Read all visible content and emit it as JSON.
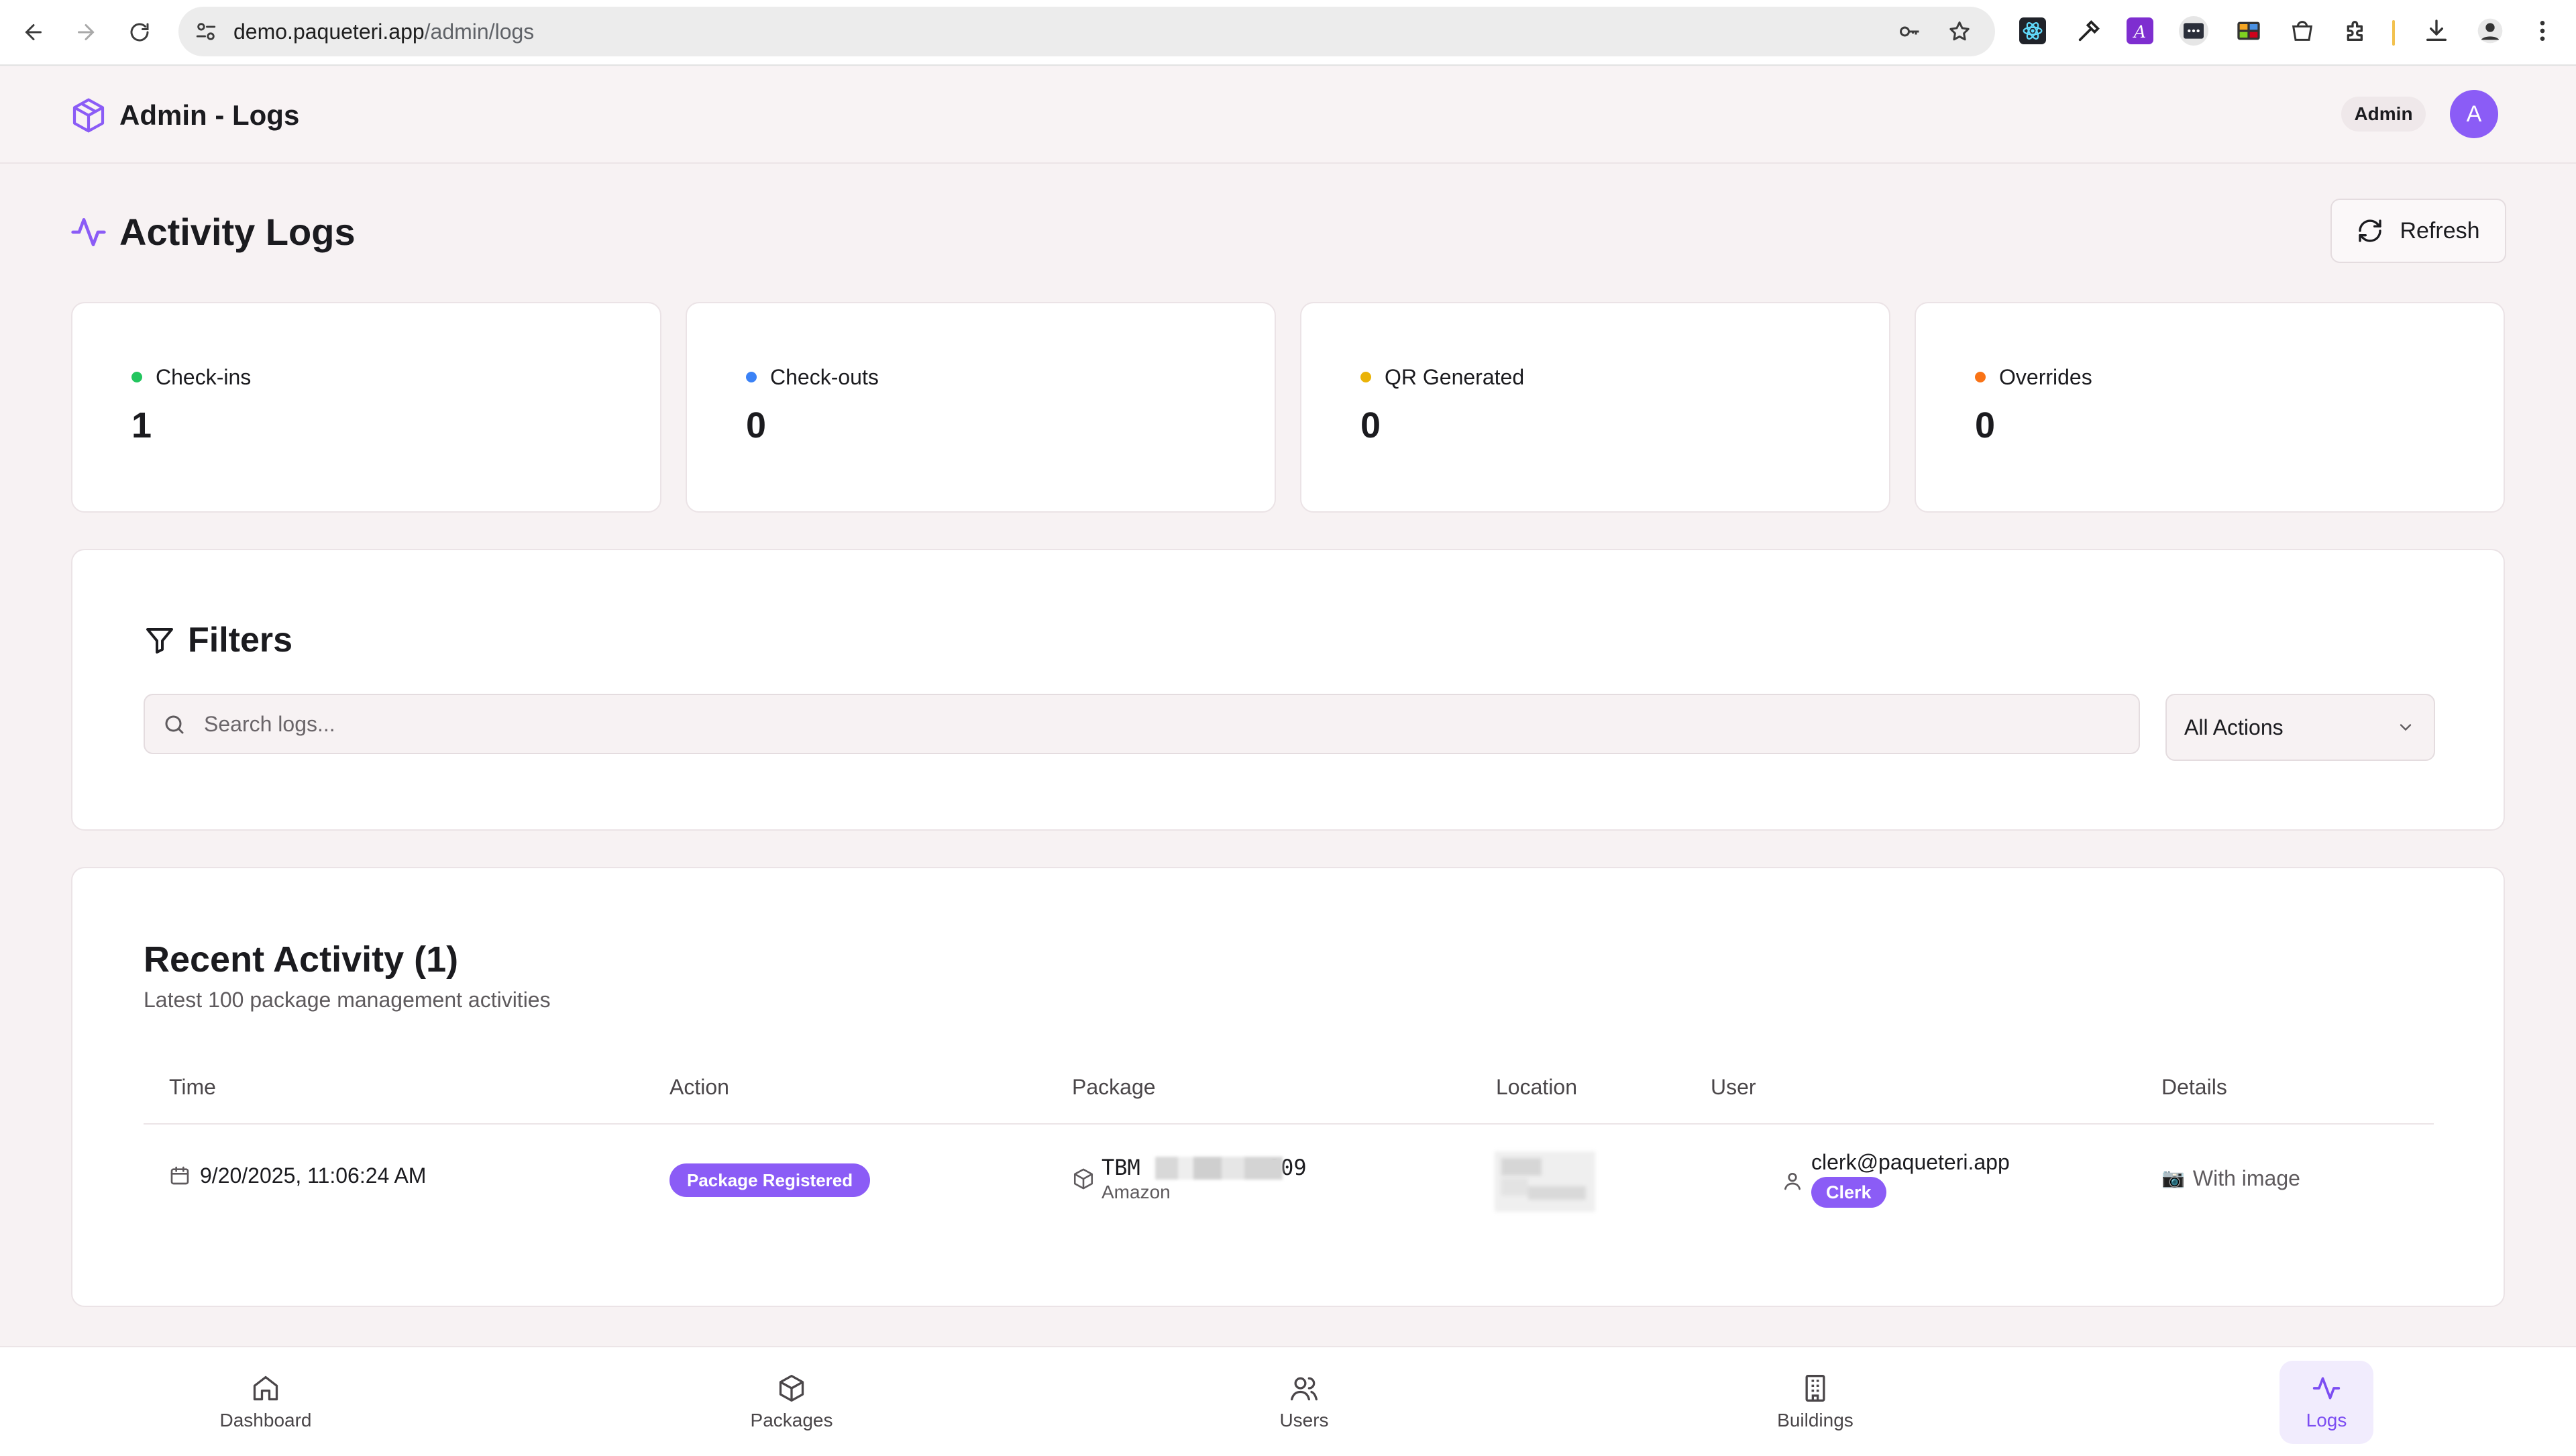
{
  "browser": {
    "url_domain": "demo.paqueteri.app",
    "url_path": "/admin/logs"
  },
  "header": {
    "title": "Admin - Logs",
    "role": "Admin",
    "avatar_initial": "A"
  },
  "page": {
    "title": "Activity Logs",
    "refresh_label": "Refresh"
  },
  "stats": [
    {
      "label": "Check-ins",
      "value": "1",
      "color": "#22c55e"
    },
    {
      "label": "Check-outs",
      "value": "0",
      "color": "#3b82f6"
    },
    {
      "label": "QR Generated",
      "value": "0",
      "color": "#eab308"
    },
    {
      "label": "Overrides",
      "value": "0",
      "color": "#f97316"
    }
  ],
  "filters": {
    "title": "Filters",
    "search_placeholder": "Search logs...",
    "search_value": "",
    "action_selected": "All Actions"
  },
  "activity": {
    "title": "Recent Activity (1)",
    "subtitle": "Latest 100 package management activities",
    "columns": [
      "Time",
      "Action",
      "Package",
      "Location",
      "User",
      "Details"
    ],
    "rows": [
      {
        "time": "9/20/2025, 11:06:24 AM",
        "action": "Package Registered",
        "package_prefix": "TBM",
        "package_suffix": "009",
        "carrier": "Amazon",
        "user_email": "clerk@paqueteri.app",
        "user_role": "Clerk",
        "details_icon": "📷",
        "details": "With image"
      }
    ]
  },
  "nav": {
    "items": [
      {
        "label": "Dashboard",
        "icon": "home-icon"
      },
      {
        "label": "Packages",
        "icon": "package-icon"
      },
      {
        "label": "Users",
        "icon": "users-icon"
      },
      {
        "label": "Buildings",
        "icon": "building-icon"
      },
      {
        "label": "Logs",
        "icon": "activity-icon",
        "active": true
      }
    ]
  },
  "colors": {
    "accent": "#8b5cf6",
    "background": "#f7f2f3"
  }
}
